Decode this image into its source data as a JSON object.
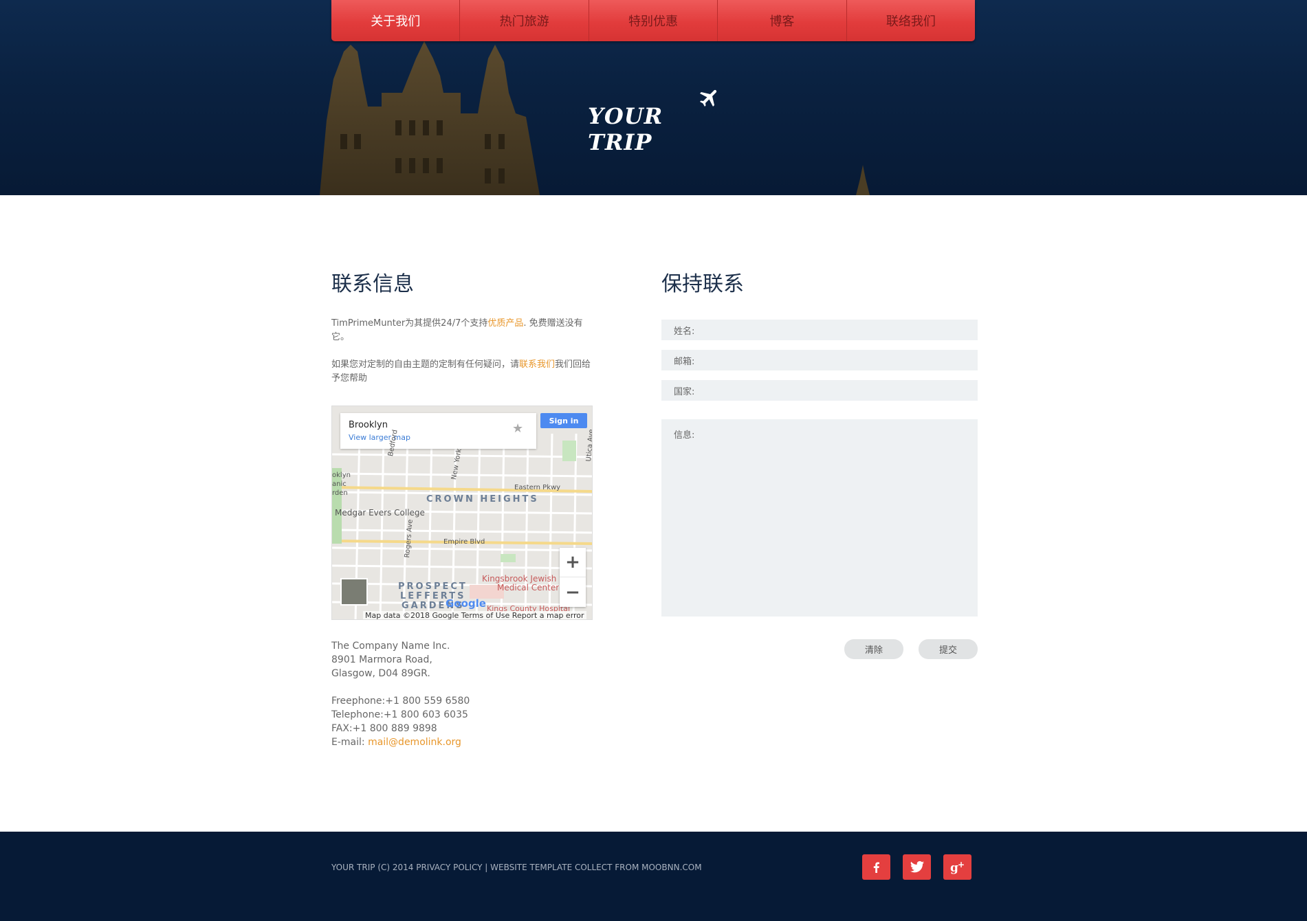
{
  "nav": {
    "items": [
      {
        "label": "关于我们",
        "active": true
      },
      {
        "label": "热门旅游",
        "active": false
      },
      {
        "label": "特别优惠",
        "active": false
      },
      {
        "label": "博客",
        "active": false
      },
      {
        "label": "联络我们",
        "active": false
      }
    ]
  },
  "logo": {
    "text": "YOUR TRIP",
    "icon": "airplane-icon"
  },
  "contact_info": {
    "title": "联系信息",
    "para1_pre": "TimPrimeMunter为其提供24/7个支持",
    "para1_link": "优质产品",
    "para1_post": ". 免费赠送没有它。",
    "para2_pre": "如果您对定制的自由主题的定制有任何疑问，请",
    "para2_link": "联系我们",
    "para2_post": "我们回给予您帮助",
    "map": {
      "place": "Brooklyn",
      "view_larger": "View larger map",
      "sign_in": "Sign in",
      "labels": {
        "crown_heights": "CROWN HEIGHTS",
        "prospect": "PROSPECT",
        "lefferts": "LEFFERTS",
        "gardens": "GARDENS",
        "kingsbrook1": "Kingsbrook Jewish",
        "kingsbrook2": "Medical Center",
        "medgar": "Medgar Evers College",
        "eastern": "Eastern Pkwy",
        "empire": "Empire Blvd",
        "brooklyn1": "oklyn",
        "brooklyn2": "anic",
        "brooklyn3": "rden",
        "bedford": "Bedford",
        "new_york": "New York",
        "utica": "Utica Ave",
        "rogers": "Rogers Ave",
        "kings_county": "Kings County Hospital"
      },
      "google": "Google",
      "footer": "Map data ©2018 Google   Terms of Use   Report a map error"
    },
    "address": [
      "The Company Name Inc.",
      "8901 Marmora Road,",
      "Glasgow, D04 89GR."
    ],
    "freephone": "Freephone:+1 800 559 6580",
    "telephone": "Telephone:+1 800 603 6035",
    "fax": "FAX:+1 800 889 9898",
    "email_label": "E-mail: ",
    "email": "mail@demolink.org"
  },
  "form": {
    "title": "保持联系",
    "name_label": "姓名:",
    "email_label": "邮箱:",
    "country_label": "国家:",
    "message_label": "信息:",
    "clear_label": "清除",
    "submit_label": "提交"
  },
  "footer": {
    "text": "YOUR TRIP (C) 2014 PRIVACY POLICY | WEBSITE TEMPLATE COLLECT FROM MOOBNN.COM",
    "social": [
      "facebook-icon",
      "twitter-icon",
      "google-plus-icon"
    ]
  },
  "colors": {
    "nav_red": "#e23c3c",
    "accent": "#e8962a",
    "header_bg": "#0a2140",
    "footer_bg": "#061a36"
  }
}
